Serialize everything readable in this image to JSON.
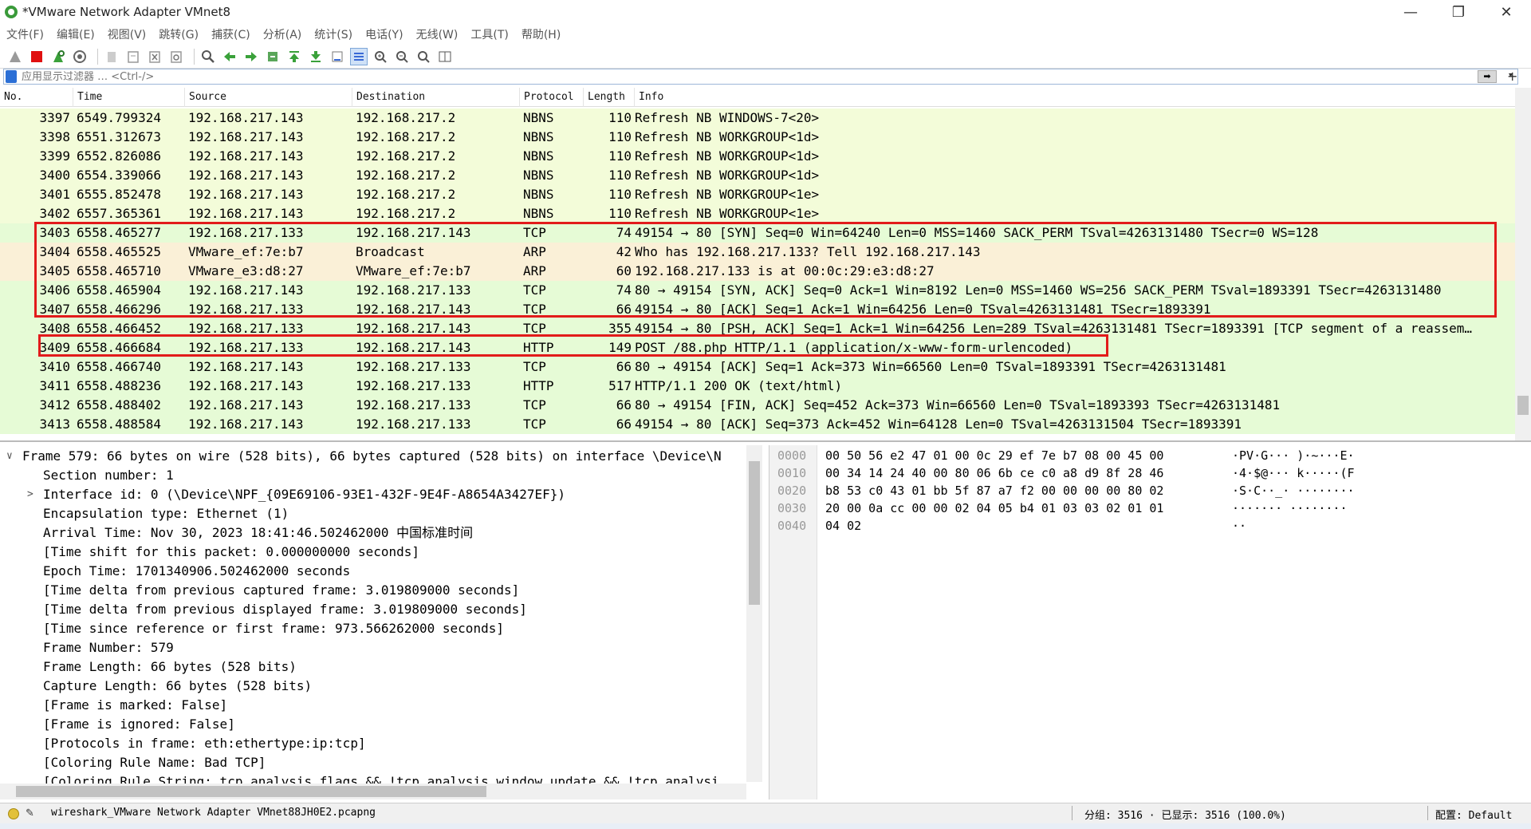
{
  "window": {
    "title": "*VMware Network Adapter VMnet8",
    "controls": {
      "minimize": "—",
      "maximize": "❐",
      "close": "✕"
    }
  },
  "menu": [
    "文件(F)",
    "编辑(E)",
    "视图(V)",
    "跳转(G)",
    "捕获(C)",
    "分析(A)",
    "统计(S)",
    "电话(Y)",
    "无线(W)",
    "工具(T)",
    "帮助(H)"
  ],
  "filter": {
    "placeholder": "应用显示过滤器 … <Ctrl-/>",
    "apply_label": "➡",
    "dropdown": "▾",
    "add": "+"
  },
  "packet_list": {
    "columns": [
      "No.",
      "Time",
      "Source",
      "Destination",
      "Protocol",
      "Length",
      "Info"
    ],
    "rows": [
      {
        "no": "3397",
        "time": "6549.799324",
        "src": "192.168.217.143",
        "dst": "192.168.217.2",
        "proto": "NBNS",
        "len": "110",
        "info": "Refresh NB WINDOWS-7<20>",
        "color": "#f3fcd9"
      },
      {
        "no": "3398",
        "time": "6551.312673",
        "src": "192.168.217.143",
        "dst": "192.168.217.2",
        "proto": "NBNS",
        "len": "110",
        "info": "Refresh NB WORKGROUP<1d>",
        "color": "#f3fcd9"
      },
      {
        "no": "3399",
        "time": "6552.826086",
        "src": "192.168.217.143",
        "dst": "192.168.217.2",
        "proto": "NBNS",
        "len": "110",
        "info": "Refresh NB WORKGROUP<1d>",
        "color": "#f3fcd9"
      },
      {
        "no": "3400",
        "time": "6554.339066",
        "src": "192.168.217.143",
        "dst": "192.168.217.2",
        "proto": "NBNS",
        "len": "110",
        "info": "Refresh NB WORKGROUP<1d>",
        "color": "#f3fcd9"
      },
      {
        "no": "3401",
        "time": "6555.852478",
        "src": "192.168.217.143",
        "dst": "192.168.217.2",
        "proto": "NBNS",
        "len": "110",
        "info": "Refresh NB WORKGROUP<1e>",
        "color": "#f3fcd9"
      },
      {
        "no": "3402",
        "time": "6557.365361",
        "src": "192.168.217.143",
        "dst": "192.168.217.2",
        "proto": "NBNS",
        "len": "110",
        "info": "Refresh NB WORKGROUP<1e>",
        "color": "#f3fcd9"
      },
      {
        "no": "3403",
        "time": "6558.465277",
        "src": "192.168.217.133",
        "dst": "192.168.217.143",
        "proto": "TCP",
        "len": "74",
        "info": "49154 → 80 [SYN] Seq=0 Win=64240 Len=0 MSS=1460 SACK_PERM TSval=4263131480 TSecr=0 WS=128",
        "color": "#e6fbd6"
      },
      {
        "no": "3404",
        "time": "6558.465525",
        "src": "VMware_ef:7e:b7",
        "dst": "Broadcast",
        "proto": "ARP",
        "len": "42",
        "info": "Who has 192.168.217.133? Tell 192.168.217.143",
        "color": "#faf0d7"
      },
      {
        "no": "3405",
        "time": "6558.465710",
        "src": "VMware_e3:d8:27",
        "dst": "VMware_ef:7e:b7",
        "proto": "ARP",
        "len": "60",
        "info": "192.168.217.133 is at 00:0c:29:e3:d8:27",
        "color": "#faf0d7"
      },
      {
        "no": "3406",
        "time": "6558.465904",
        "src": "192.168.217.143",
        "dst": "192.168.217.133",
        "proto": "TCP",
        "len": "74",
        "info": "80 → 49154 [SYN, ACK] Seq=0 Ack=1 Win=8192 Len=0 MSS=1460 WS=256 SACK_PERM TSval=1893391 TSecr=4263131480",
        "color": "#e6fbd6"
      },
      {
        "no": "3407",
        "time": "6558.466296",
        "src": "192.168.217.133",
        "dst": "192.168.217.143",
        "proto": "TCP",
        "len": "66",
        "info": "49154 → 80 [ACK] Seq=1 Ack=1 Win=64256 Len=0 TSval=4263131481 TSecr=1893391",
        "color": "#e6fbd6"
      },
      {
        "no": "3408",
        "time": "6558.466452",
        "src": "192.168.217.133",
        "dst": "192.168.217.143",
        "proto": "TCP",
        "len": "355",
        "info": "49154 → 80 [PSH, ACK] Seq=1 Ack=1 Win=64256 Len=289 TSval=4263131481 TSecr=1893391 [TCP segment of a reassem…",
        "color": "#e6fbd6"
      },
      {
        "no": "3409",
        "time": "6558.466684",
        "src": "192.168.217.133",
        "dst": "192.168.217.143",
        "proto": "HTTP",
        "len": "149",
        "info": "POST /88.php HTTP/1.1  (application/x-www-form-urlencoded)",
        "color": "#e6fbd6"
      },
      {
        "no": "3410",
        "time": "6558.466740",
        "src": "192.168.217.143",
        "dst": "192.168.217.133",
        "proto": "TCP",
        "len": "66",
        "info": "80 → 49154 [ACK] Seq=1 Ack=373 Win=66560 Len=0 TSval=1893391 TSecr=4263131481",
        "color": "#e6fbd6"
      },
      {
        "no": "3411",
        "time": "6558.488236",
        "src": "192.168.217.143",
        "dst": "192.168.217.133",
        "proto": "HTTP",
        "len": "517",
        "info": "HTTP/1.1 200 OK  (text/html)",
        "color": "#e6fbd6"
      },
      {
        "no": "3412",
        "time": "6558.488402",
        "src": "192.168.217.143",
        "dst": "192.168.217.133",
        "proto": "TCP",
        "len": "66",
        "info": "80 → 49154 [FIN, ACK] Seq=452 Ack=373 Win=66560 Len=0 TSval=1893393 TSecr=4263131481",
        "color": "#e6fbd6"
      },
      {
        "no": "3413",
        "time": "6558.488584",
        "src": "192.168.217.143",
        "dst": "192.168.217.133",
        "proto": "TCP",
        "len": "66",
        "info": "49154 → 80 [ACK] Seq=373 Ack=452 Win=64128 Len=0 TSval=4263131504 TSecr=1893391",
        "color": "#e6fbd6"
      }
    ]
  },
  "details": {
    "lines": [
      {
        "text": "Frame 579: 66 bytes on wire (528 bits), 66 bytes captured (528 bits) on interface \\Device\\N",
        "expander": "∨",
        "indent": 0
      },
      {
        "text": "Section number: 1",
        "expander": "",
        "indent": 1
      },
      {
        "text": "Interface id: 0 (\\Device\\NPF_{09E69106-93E1-432F-9E4F-A8654A3427EF})",
        "expander": ">",
        "indent": 1
      },
      {
        "text": "Encapsulation type: Ethernet (1)",
        "expander": "",
        "indent": 1
      },
      {
        "text": "Arrival Time: Nov 30, 2023 18:41:46.502462000 中国标准时间",
        "expander": "",
        "indent": 1
      },
      {
        "text": "[Time shift for this packet: 0.000000000 seconds]",
        "expander": "",
        "indent": 1
      },
      {
        "text": "Epoch Time: 1701340906.502462000 seconds",
        "expander": "",
        "indent": 1
      },
      {
        "text": "[Time delta from previous captured frame: 3.019809000 seconds]",
        "expander": "",
        "indent": 1
      },
      {
        "text": "[Time delta from previous displayed frame: 3.019809000 seconds]",
        "expander": "",
        "indent": 1
      },
      {
        "text": "[Time since reference or first frame: 973.566262000 seconds]",
        "expander": "",
        "indent": 1
      },
      {
        "text": "Frame Number: 579",
        "expander": "",
        "indent": 1
      },
      {
        "text": "Frame Length: 66 bytes (528 bits)",
        "expander": "",
        "indent": 1
      },
      {
        "text": "Capture Length: 66 bytes (528 bits)",
        "expander": "",
        "indent": 1
      },
      {
        "text": "[Frame is marked: False]",
        "expander": "",
        "indent": 1
      },
      {
        "text": "[Frame is ignored: False]",
        "expander": "",
        "indent": 1
      },
      {
        "text": "[Protocols in frame: eth:ethertype:ip:tcp]",
        "expander": "",
        "indent": 1
      },
      {
        "text": "[Coloring Rule Name: Bad TCP]",
        "expander": "",
        "indent": 1
      },
      {
        "text": "[Coloring Rule String: tcp.analysis.flags && !tcp.analysis.window_update && !tcp.analysi",
        "expander": "",
        "indent": 1
      }
    ]
  },
  "bytes": {
    "rows": [
      {
        "offset": "0000",
        "hex": "00 50 56 e2 47 01 00 0c  29 ef 7e b7 08 00 45 00",
        "ascii": "·PV·G···  )·~···E·"
      },
      {
        "offset": "0010",
        "hex": "00 34 14 24 40 00 80 06  6b ce c0 a8 d9 8f 28 46",
        "ascii": "·4·$@···  k·····(F"
      },
      {
        "offset": "0020",
        "hex": "b8 53 c0 43 01 bb 5f 87  a7 f2 00 00 00 00 80 02",
        "ascii": "·S·C··_·  ········"
      },
      {
        "offset": "0030",
        "hex": "20 00 0a cc 00 00 02 04  05 b4 01 03 03 02 01 01",
        "ascii": " ·······  ········"
      },
      {
        "offset": "0040",
        "hex": "04 02",
        "ascii": "··"
      }
    ]
  },
  "status": {
    "file": "wireshark_VMware Network Adapter VMnet88JH0E2.pcapng",
    "packets": "分组: 3516 · 已显示: 3516 (100.0%)",
    "profile": "配置: Default"
  },
  "colors": {
    "highlight_box": "#e21b1b"
  }
}
